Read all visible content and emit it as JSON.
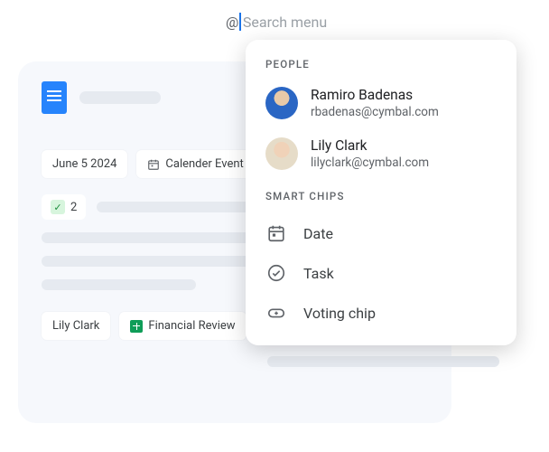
{
  "search": {
    "at": "@",
    "placeholder": "Search menu"
  },
  "menu": {
    "people_label": "PEOPLE",
    "people": [
      {
        "name": "Ramiro Badenas",
        "email": "rbadenas@cymbal.com"
      },
      {
        "name": "Lily Clark",
        "email": "lilyclark@cymbal.com"
      }
    ],
    "chips_label": "SMART CHIPS",
    "chips": [
      {
        "label": "Date"
      },
      {
        "label": "Task"
      },
      {
        "label": "Voting chip"
      }
    ]
  },
  "doc": {
    "date_chip": "June 5 2024",
    "event_chip": "Calender Event",
    "vote_count": "2",
    "person_chip": "Lily Clark",
    "sheet_chip": "Financial Review"
  }
}
